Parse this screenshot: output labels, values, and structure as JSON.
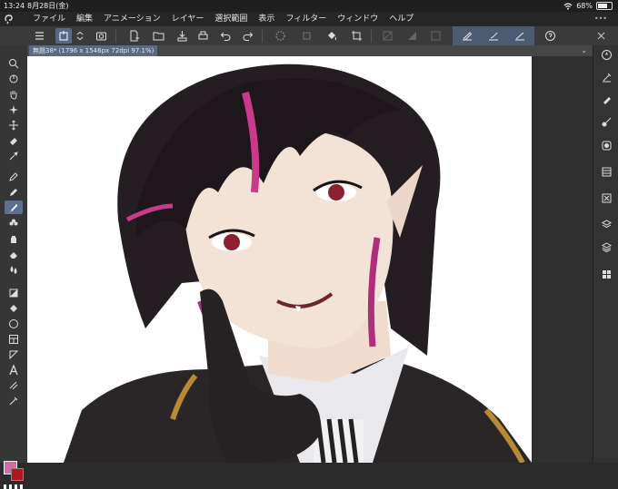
{
  "status": {
    "time": "13:24",
    "date": "8月28日(金)",
    "battery": "68%",
    "battery_level": 0.68
  },
  "menu": {
    "items": [
      "ファイル",
      "編集",
      "アニメーション",
      "レイヤー",
      "選択範囲",
      "表示",
      "フィルター",
      "ウィンドウ",
      "ヘルプ"
    ],
    "dots": "•••"
  },
  "toolbar": {
    "icons": [
      "menu-icon",
      "new-canvas-icon",
      "stepper-icon",
      "camera-icon",
      "new-file-icon",
      "open-folder-icon",
      "save-icon",
      "print-icon",
      "undo-icon",
      "redo-icon",
      "loading-icon",
      "transform-icon",
      "fill-icon",
      "crop-icon",
      "grid-icon",
      "gradient-icon",
      "ruler-icon",
      "stabilizer-pen-icon",
      "stabilizer-brush-icon",
      "stabilizer-line-icon",
      "help-icon"
    ]
  },
  "document": {
    "tab_label": "無題38* (1796 x 1546px 72dpi 97.1%)"
  },
  "colors": {
    "main": "#d46aa0",
    "sub": "#b3141c",
    "accent": "#556a86"
  }
}
